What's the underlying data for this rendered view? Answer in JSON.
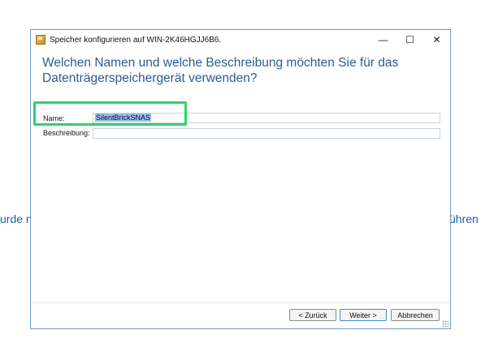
{
  "background": {
    "left_text": "urde n",
    "right_text": "ühren"
  },
  "window": {
    "title": "Speicher konfigurieren auf WIN-2K46HGJJ6B6.",
    "controls": {
      "minimize": "—",
      "maximize": "☐",
      "close": "✕"
    }
  },
  "header": {
    "heading": "Welchen Namen und welche Beschreibung möchten Sie für das Datenträgerspeichergerät verwenden?"
  },
  "form": {
    "name_label": "Name:",
    "name_value": "SilentBrickSNAS",
    "description_label": "Beschreibung:",
    "description_value": ""
  },
  "buttons": {
    "back": "< Zurück",
    "next": "Weiter >",
    "cancel": "Abbrechen"
  },
  "colors": {
    "heading": "#2b5c91",
    "highlight": "#2ed36a",
    "selection": "#99c1eb"
  }
}
